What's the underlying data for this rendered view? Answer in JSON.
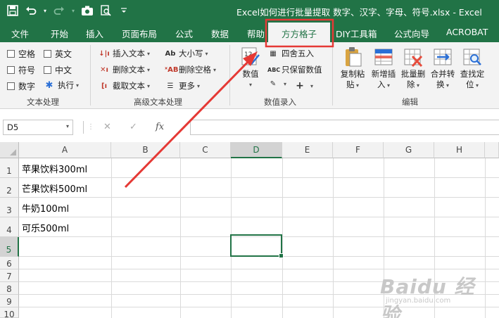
{
  "app": {
    "title": "Excel如何进行批量提取 数字、汉字、字母、符号.xlsx  -  Excel"
  },
  "quick_access": [
    {
      "name": "save-icon",
      "glyph": "💾"
    },
    {
      "name": "undo-icon",
      "glyph": "↶"
    },
    {
      "name": "redo-icon",
      "glyph": "↷"
    },
    {
      "name": "camera-icon",
      "glyph": "📷"
    },
    {
      "name": "print-preview-icon",
      "glyph": "🔍"
    },
    {
      "name": "customize-qat-icon",
      "glyph": "⌄"
    }
  ],
  "menu_tabs": [
    "文件",
    "开始",
    "插入",
    "页面布局",
    "公式",
    "数据",
    "帮助",
    "方方格子",
    "DIY工具箱",
    "公式向导",
    "ACROBAT"
  ],
  "active_tab": "方方格子",
  "ribbon": {
    "text_processing": {
      "label": "文本处理",
      "checkboxes": [
        "空格",
        "英文",
        "符号",
        "中文",
        "数字"
      ],
      "execute": "执行"
    },
    "advanced_text": {
      "label": "高级文本处理",
      "items": [
        "插入文本",
        "删除文本",
        "截取文本",
        "大小写",
        "删除空格",
        "更多"
      ]
    },
    "data_entry": {
      "label": "数值录入",
      "numeric": "数值",
      "round": "四舍五入",
      "keep_values": "只保留数值"
    },
    "edit": {
      "label": "编辑",
      "buttons": [
        [
          "复制粘",
          "贴"
        ],
        [
          "新增插",
          "入"
        ],
        [
          "批量删",
          "除"
        ],
        [
          "合并转",
          "换"
        ],
        [
          "查找定",
          "位"
        ]
      ]
    }
  },
  "formula_bar": {
    "name_box": "D5",
    "cancel": "✕",
    "enter": "✓",
    "fx": "fx",
    "value": ""
  },
  "sheet": {
    "columns": [
      "A",
      "B",
      "C",
      "D",
      "E",
      "F",
      "G",
      "H"
    ],
    "rows": [
      "1",
      "2",
      "3",
      "4",
      "5",
      "6",
      "7",
      "8",
      "9",
      "10"
    ],
    "selected_cell": "D5",
    "cells": {
      "A1": "苹果饮料300ml",
      "A2": "芒果饮料500ml",
      "A3": "牛奶100ml",
      "A4": "可乐500ml"
    }
  },
  "watermark": {
    "main": "Baidu 经验",
    "sub": "jingyan.baidu.com"
  },
  "colors": {
    "excel_green": "#217346",
    "annotation_red": "#e53935"
  }
}
